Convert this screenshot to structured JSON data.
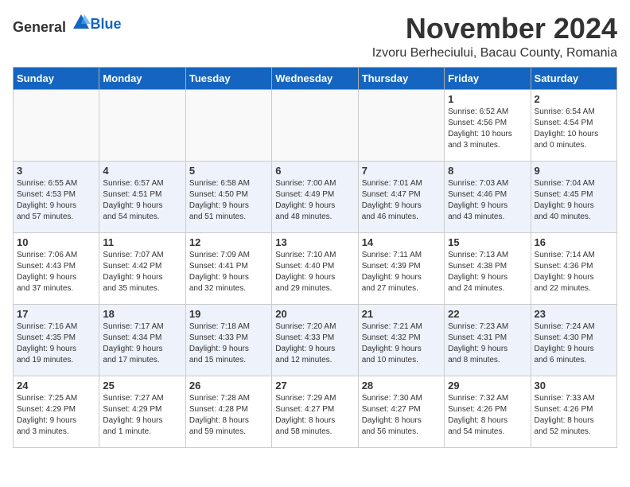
{
  "header": {
    "logo_general": "General",
    "logo_blue": "Blue",
    "month": "November 2024",
    "location": "Izvoru Berheciului, Bacau County, Romania"
  },
  "days_of_week": [
    "Sunday",
    "Monday",
    "Tuesday",
    "Wednesday",
    "Thursday",
    "Friday",
    "Saturday"
  ],
  "weeks": [
    [
      {
        "day": "",
        "info": ""
      },
      {
        "day": "",
        "info": ""
      },
      {
        "day": "",
        "info": ""
      },
      {
        "day": "",
        "info": ""
      },
      {
        "day": "",
        "info": ""
      },
      {
        "day": "1",
        "info": "Sunrise: 6:52 AM\nSunset: 4:56 PM\nDaylight: 10 hours\nand 3 minutes."
      },
      {
        "day": "2",
        "info": "Sunrise: 6:54 AM\nSunset: 4:54 PM\nDaylight: 10 hours\nand 0 minutes."
      }
    ],
    [
      {
        "day": "3",
        "info": "Sunrise: 6:55 AM\nSunset: 4:53 PM\nDaylight: 9 hours\nand 57 minutes."
      },
      {
        "day": "4",
        "info": "Sunrise: 6:57 AM\nSunset: 4:51 PM\nDaylight: 9 hours\nand 54 minutes."
      },
      {
        "day": "5",
        "info": "Sunrise: 6:58 AM\nSunset: 4:50 PM\nDaylight: 9 hours\nand 51 minutes."
      },
      {
        "day": "6",
        "info": "Sunrise: 7:00 AM\nSunset: 4:49 PM\nDaylight: 9 hours\nand 48 minutes."
      },
      {
        "day": "7",
        "info": "Sunrise: 7:01 AM\nSunset: 4:47 PM\nDaylight: 9 hours\nand 46 minutes."
      },
      {
        "day": "8",
        "info": "Sunrise: 7:03 AM\nSunset: 4:46 PM\nDaylight: 9 hours\nand 43 minutes."
      },
      {
        "day": "9",
        "info": "Sunrise: 7:04 AM\nSunset: 4:45 PM\nDaylight: 9 hours\nand 40 minutes."
      }
    ],
    [
      {
        "day": "10",
        "info": "Sunrise: 7:06 AM\nSunset: 4:43 PM\nDaylight: 9 hours\nand 37 minutes."
      },
      {
        "day": "11",
        "info": "Sunrise: 7:07 AM\nSunset: 4:42 PM\nDaylight: 9 hours\nand 35 minutes."
      },
      {
        "day": "12",
        "info": "Sunrise: 7:09 AM\nSunset: 4:41 PM\nDaylight: 9 hours\nand 32 minutes."
      },
      {
        "day": "13",
        "info": "Sunrise: 7:10 AM\nSunset: 4:40 PM\nDaylight: 9 hours\nand 29 minutes."
      },
      {
        "day": "14",
        "info": "Sunrise: 7:11 AM\nSunset: 4:39 PM\nDaylight: 9 hours\nand 27 minutes."
      },
      {
        "day": "15",
        "info": "Sunrise: 7:13 AM\nSunset: 4:38 PM\nDaylight: 9 hours\nand 24 minutes."
      },
      {
        "day": "16",
        "info": "Sunrise: 7:14 AM\nSunset: 4:36 PM\nDaylight: 9 hours\nand 22 minutes."
      }
    ],
    [
      {
        "day": "17",
        "info": "Sunrise: 7:16 AM\nSunset: 4:35 PM\nDaylight: 9 hours\nand 19 minutes."
      },
      {
        "day": "18",
        "info": "Sunrise: 7:17 AM\nSunset: 4:34 PM\nDaylight: 9 hours\nand 17 minutes."
      },
      {
        "day": "19",
        "info": "Sunrise: 7:18 AM\nSunset: 4:33 PM\nDaylight: 9 hours\nand 15 minutes."
      },
      {
        "day": "20",
        "info": "Sunrise: 7:20 AM\nSunset: 4:33 PM\nDaylight: 9 hours\nand 12 minutes."
      },
      {
        "day": "21",
        "info": "Sunrise: 7:21 AM\nSunset: 4:32 PM\nDaylight: 9 hours\nand 10 minutes."
      },
      {
        "day": "22",
        "info": "Sunrise: 7:23 AM\nSunset: 4:31 PM\nDaylight: 9 hours\nand 8 minutes."
      },
      {
        "day": "23",
        "info": "Sunrise: 7:24 AM\nSunset: 4:30 PM\nDaylight: 9 hours\nand 6 minutes."
      }
    ],
    [
      {
        "day": "24",
        "info": "Sunrise: 7:25 AM\nSunset: 4:29 PM\nDaylight: 9 hours\nand 3 minutes."
      },
      {
        "day": "25",
        "info": "Sunrise: 7:27 AM\nSunset: 4:29 PM\nDaylight: 9 hours\nand 1 minute."
      },
      {
        "day": "26",
        "info": "Sunrise: 7:28 AM\nSunset: 4:28 PM\nDaylight: 8 hours\nand 59 minutes."
      },
      {
        "day": "27",
        "info": "Sunrise: 7:29 AM\nSunset: 4:27 PM\nDaylight: 8 hours\nand 58 minutes."
      },
      {
        "day": "28",
        "info": "Sunrise: 7:30 AM\nSunset: 4:27 PM\nDaylight: 8 hours\nand 56 minutes."
      },
      {
        "day": "29",
        "info": "Sunrise: 7:32 AM\nSunset: 4:26 PM\nDaylight: 8 hours\nand 54 minutes."
      },
      {
        "day": "30",
        "info": "Sunrise: 7:33 AM\nSunset: 4:26 PM\nDaylight: 8 hours\nand 52 minutes."
      }
    ]
  ]
}
